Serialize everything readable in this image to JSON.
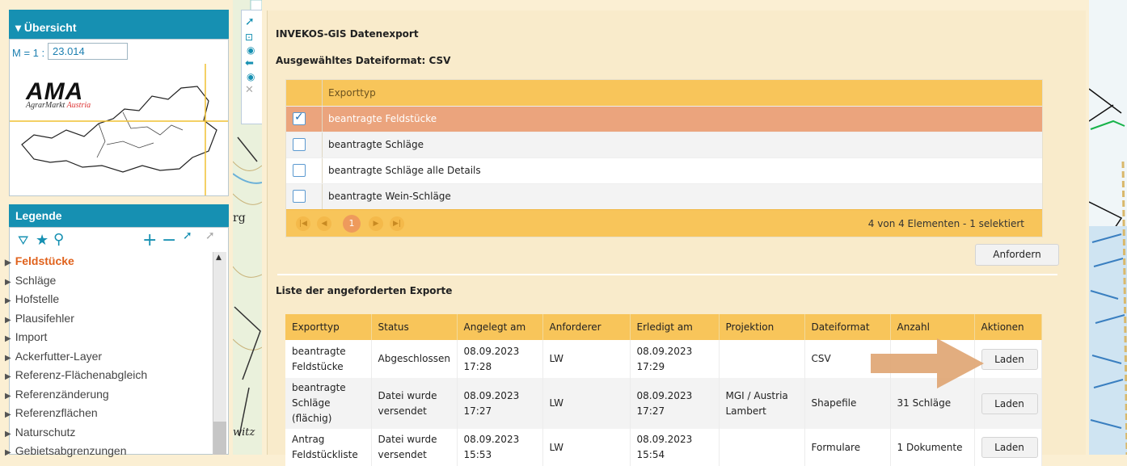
{
  "overview": {
    "title": "▾ Übersicht",
    "scale_label": "M = 1 :",
    "scale_value": "23.014",
    "logo_text": "AMA",
    "logo_sub1": "AgrarMarkt",
    "logo_sub2": "Austria"
  },
  "legend": {
    "title": "Legende",
    "items": [
      {
        "label": "Feldstücke",
        "active": true
      },
      {
        "label": "Schläge"
      },
      {
        "label": "Hofstelle"
      },
      {
        "label": "Plausifehler"
      },
      {
        "label": "Import"
      },
      {
        "label": "Ackerfutter-Layer"
      },
      {
        "label": "Referenz-Flächenabgleich"
      },
      {
        "label": "Referenzänderung"
      },
      {
        "label": "Referenzflächen"
      },
      {
        "label": "Naturschutz"
      },
      {
        "label": "Gebietsabgrenzungen"
      }
    ]
  },
  "map_labels": {
    "left1": "rg",
    "left2": "witz"
  },
  "export": {
    "title": "INVEKOS-GIS Datenexport",
    "format_heading": "Ausgewähltes Dateiformat: CSV",
    "grid_header": "Exporttyp",
    "types": [
      {
        "label": "beantragte Feldstücke",
        "checked": true
      },
      {
        "label": "beantragte Schläge",
        "checked": false
      },
      {
        "label": "beantragte Schläge alle Details",
        "checked": false
      },
      {
        "label": "beantragte Wein-Schläge",
        "checked": false
      }
    ],
    "pager_current": "1",
    "pager_info": "4 von 4 Elementen - 1 selektiert",
    "request_button": "Anfordern"
  },
  "requested": {
    "title": "Liste der angeforderten Exporte",
    "columns": [
      "Exporttyp",
      "Status",
      "Angelegt am",
      "Anforderer",
      "Erledigt am",
      "Projektion",
      "Dateiformat",
      "Anzahl",
      "Aktionen"
    ],
    "rows": [
      {
        "typ1": "beantragte",
        "typ2": "Feldstücke",
        "typ3": "",
        "status1": "Abgeschlossen",
        "status2": "",
        "angelegt1": "08.09.2023",
        "angelegt2": "17:28",
        "anforderer": "LW",
        "erledigt1": "08.09.2023",
        "erledigt2": "17:29",
        "projektion1": "",
        "projektion2": "",
        "format": "CSV",
        "anzahl": "",
        "action": "Laden"
      },
      {
        "typ1": "beantragte",
        "typ2": "Schläge",
        "typ3": "(flächig)",
        "status1": "Datei wurde",
        "status2": "versendet",
        "angelegt1": "08.09.2023",
        "angelegt2": "17:27",
        "anforderer": "LW",
        "erledigt1": "08.09.2023",
        "erledigt2": "17:27",
        "projektion1": "MGI / Austria",
        "projektion2": "Lambert",
        "format": "Shapefile",
        "anzahl": "31 Schläge",
        "action": "Laden"
      },
      {
        "typ1": "Antrag",
        "typ2": "Feldstückliste",
        "typ3": "",
        "status1": "Datei wurde",
        "status2": "versendet",
        "angelegt1": "08.09.2023",
        "angelegt2": "15:53",
        "anforderer": "LW",
        "erledigt1": "08.09.2023",
        "erledigt2": "15:54",
        "projektion1": "",
        "projektion2": "",
        "format": "Formulare",
        "anzahl": "1 Dokumente",
        "action": "Laden"
      }
    ]
  },
  "colors": {
    "accent": "#1690b2",
    "header": "#f8c55a",
    "selected_row": "#eba47d",
    "arrow": "#e0a674"
  }
}
